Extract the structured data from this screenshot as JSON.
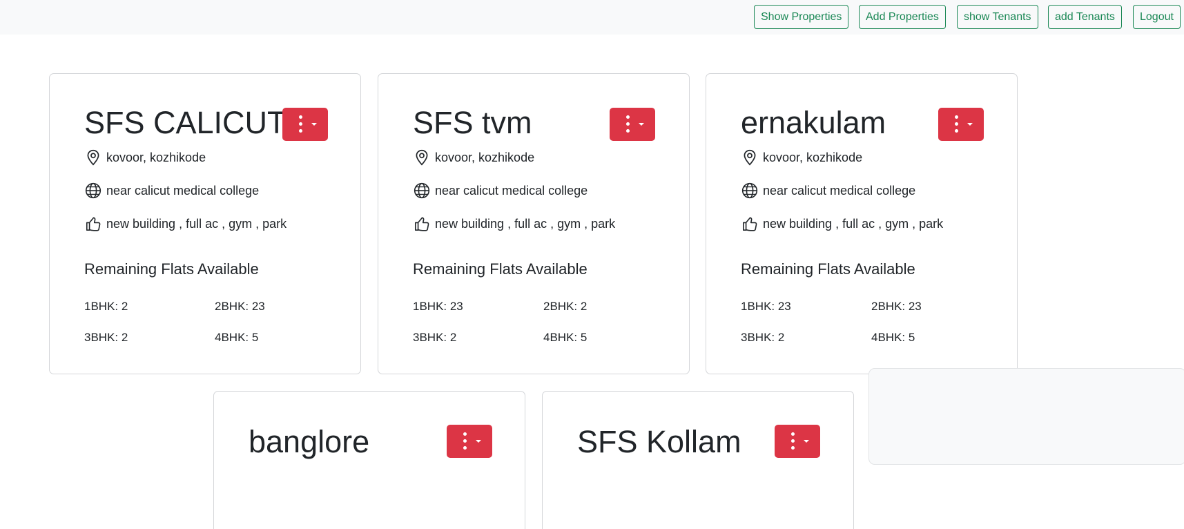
{
  "nav": {
    "show_properties": "Show Properties",
    "add_properties": "Add Properties",
    "show_tenants": "show Tenants",
    "add_tenants": "add Tenants",
    "logout": "Logout"
  },
  "labels": {
    "remaining": "Remaining Flats Available"
  },
  "properties": [
    {
      "title": "SFS CALICUT",
      "location": "kovoor, kozhikode",
      "landmark": "near calicut medical college",
      "features": "new building , full ac , gym , park",
      "flats": [
        "1BHK: 2",
        "2BHK: 23",
        "3BHK: 2",
        "4BHK: 5"
      ]
    },
    {
      "title": "SFS tvm",
      "location": "kovoor, kozhikode",
      "landmark": "near calicut medical college",
      "features": "new building , full ac , gym , park",
      "flats": [
        "1BHK: 23",
        "2BHK: 2",
        "3BHK: 2",
        "4BHK: 5"
      ]
    },
    {
      "title": "ernakulam",
      "location": "kovoor, kozhikode",
      "landmark": "near calicut medical college",
      "features": "new building , full ac , gym , park",
      "flats": [
        "1BHK: 23",
        "2BHK: 23",
        "3BHK: 2",
        "4BHK: 5"
      ]
    },
    {
      "title": "banglore"
    },
    {
      "title": "SFS Kollam"
    }
  ],
  "colors": {
    "nav_accent": "#198754",
    "menu_button": "#dc3545"
  },
  "icons": {
    "location": "geo-alt-icon",
    "landmark": "globe-icon",
    "features": "thumbs-up-icon",
    "menu": "kebab-menu-icon"
  }
}
